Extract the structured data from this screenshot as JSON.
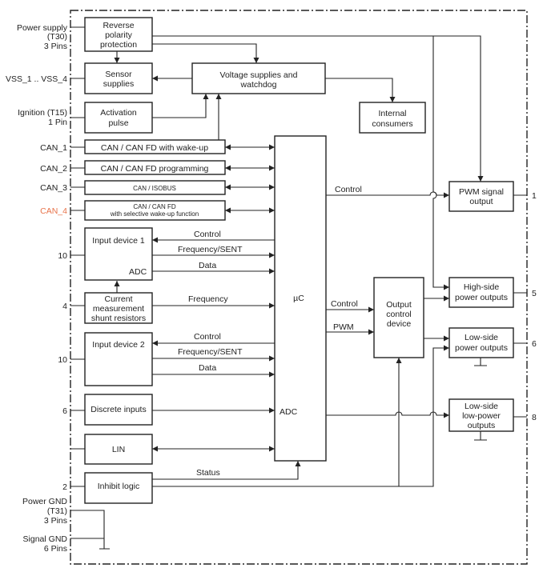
{
  "colors": {
    "line": "#222222",
    "highlight_pin": "#e8734a"
  },
  "pins_left": {
    "power_supply": [
      "Power supply",
      "(T30)",
      "3 Pins"
    ],
    "vss": "VSS_1 .. VSS_4",
    "ignition": [
      "Ignition (T15)",
      "1 Pin"
    ],
    "can1": "CAN_1",
    "can2": "CAN_2",
    "can3": "CAN_3",
    "can4": "CAN_4",
    "input1": "10",
    "current": "4",
    "input2": "10",
    "discrete": "6",
    "inhibit": "2",
    "power_gnd": [
      "Power GND",
      "(T31)",
      "3 Pins"
    ],
    "signal_gnd": [
      "Signal GND",
      "6 Pins"
    ]
  },
  "pins_right": {
    "pwm": "1",
    "high_side": "5",
    "low_side": "6",
    "low_power": "8"
  },
  "blocks": {
    "reverse": [
      "Reverse",
      "polarity",
      "protection"
    ],
    "sensor": [
      "Sensor",
      "supplies"
    ],
    "voltage": [
      "Voltage supplies and",
      "watchdog"
    ],
    "activation": [
      "Activation",
      "pulse"
    ],
    "internal": [
      "Internal",
      "consumers"
    ],
    "can1": "CAN / CAN FD with wake-up",
    "can2": "CAN / CAN FD programming",
    "can3": "CAN / ISOBUS",
    "can4": [
      "CAN / CAN FD",
      "with selective wake-up function"
    ],
    "input1": "Input device 1",
    "input1_adc": "ADC",
    "current": [
      "Current",
      "measurement",
      "shunt resistors"
    ],
    "input2": "Input device 2",
    "discrete": "Discrete inputs",
    "lin": "LIN",
    "inhibit": "Inhibit logic",
    "uc": "µC",
    "uc_adc": "ADC",
    "output_control": [
      "Output",
      "control",
      "device"
    ],
    "pwm_out": [
      "PWM signal",
      "output"
    ],
    "high_side": [
      "High-side",
      "power outputs"
    ],
    "low_side": [
      "Low-side",
      "power outputs"
    ],
    "low_power": [
      "Low-side",
      "low-power",
      "outputs"
    ]
  },
  "signals": {
    "control_pwm": "Control",
    "control1": "Control",
    "freq_sent1": "Frequency/SENT",
    "data1": "Data",
    "frequency": "Frequency",
    "control2": "Control",
    "freq_sent2": "Frequency/SENT",
    "data2": "Data",
    "control_out": "Control",
    "pwm": "PWM",
    "status": "Status"
  }
}
